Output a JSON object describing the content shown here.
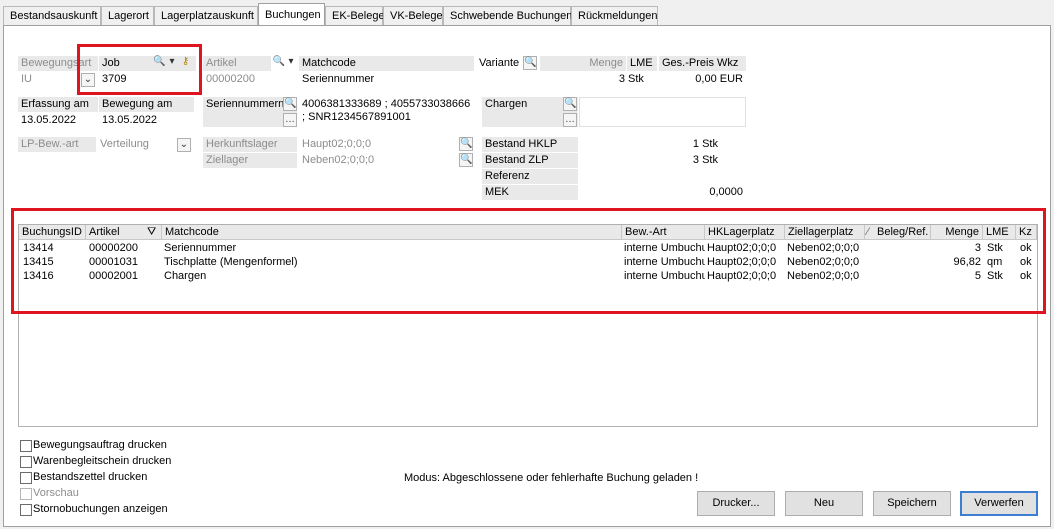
{
  "tabs": [
    "Bestandsauskunft",
    "Lagerort",
    "Lagerplatzauskunft",
    "Buchungen",
    "EK-Belege",
    "VK-Belege",
    "Schwebende Buchungen",
    "Rückmeldungen"
  ],
  "form": {
    "bewegungsart_label": "Bewegungsart",
    "bewegungsart_value": "IU",
    "job_label": "Job",
    "job_value": "3709",
    "artikel_label": "Artikel",
    "artikel_value": "00000200",
    "matchcode_label": "Matchcode",
    "matchcode_value": "Seriennummer",
    "variante_label": "Variante",
    "menge_label": "Menge",
    "menge_value": "3",
    "lme_label": "LME",
    "lme_value": "Stk",
    "gespreis_label": "Ges.-Preis Wkz",
    "gespreis_value": "0,00 EUR",
    "erfassung_label": "Erfassung am",
    "erfassung_value": "13.05.2022",
    "bewegung_label": "Bewegung am",
    "bewegung_value": "13.05.2022",
    "seriennummern_label": "Seriennummern",
    "seriennummern_value1": "4006381333689 ; 4055733038666",
    "seriennummern_value2": "; SNR1234567891001",
    "chargen_label": "Chargen",
    "lpbewart_label": "LP-Bew.-art",
    "lpbewart_value": "Verteilung",
    "herkunftslager_label": "Herkunftslager",
    "herkunftslager_value": "Haupt02;0;0;0",
    "ziellager_label": "Ziellager",
    "ziellager_value": "Neben02;0;0;0",
    "bestand_hklp_label": "Bestand HKLP",
    "bestand_hklp_value": "1 Stk",
    "bestand_zlp_label": "Bestand ZLP",
    "bestand_zlp_value": "3 Stk",
    "referenz_label": "Referenz",
    "referenz_value": "",
    "mek_label": "MEK",
    "mek_value": "0,0000"
  },
  "grid": {
    "columns": [
      "BuchungsID",
      "Artikel",
      "Matchcode",
      "Bew.-Art",
      "HKLagerplatz",
      "Ziellagerplatz",
      "Beleg/Ref.",
      "Menge",
      "LME",
      "Kz"
    ],
    "rows": [
      [
        "13414",
        "00000200",
        "Seriennummer",
        "interne Umbuchu",
        "Haupt02;0;0;0",
        "Neben02;0;0;0",
        "",
        "3",
        "Stk",
        "ok"
      ],
      [
        "13415",
        "00001031",
        "Tischplatte (Mengenformel)",
        "interne Umbuchu",
        "Haupt02;0;0;0",
        "Neben02;0;0;0",
        "",
        "96,82",
        "qm",
        "ok"
      ],
      [
        "13416",
        "00002001",
        "Chargen",
        "interne Umbuchu",
        "Haupt02;0;0;0",
        "Neben02;0;0;0",
        "",
        "5",
        "Stk",
        "ok"
      ]
    ]
  },
  "options": [
    "Bewegungsauftrag drucken",
    "Warenbegleitschein drucken",
    "Bestandszettel drucken",
    "Vorschau",
    "Stornobuchungen anzeigen"
  ],
  "status": "Modus: Abgeschlossene oder fehlerhafte Buchung geladen !",
  "buttons": {
    "drucker": "Drucker...",
    "neu": "Neu",
    "speichern": "Speichern",
    "verwerfen": "Verwerfen"
  },
  "colors": {
    "highlight": "#e0141e",
    "default_button": "#3c7fd1"
  }
}
